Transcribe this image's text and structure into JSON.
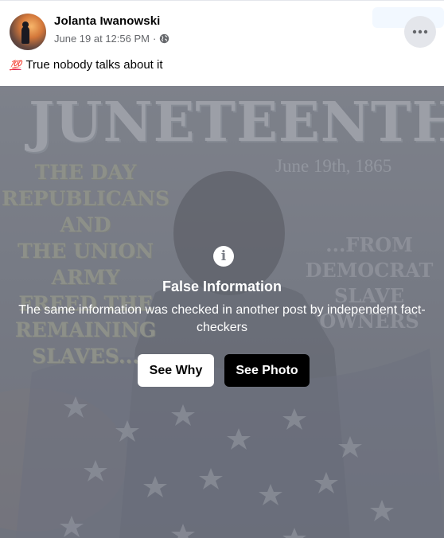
{
  "post": {
    "author": "Jolanta Iwanowski",
    "timestamp": "June 19 at 12:56 PM",
    "separator": "·",
    "audience_icon": "globe-icon",
    "more_icon": "more-horizontal-icon",
    "caption_emoji": "💯",
    "caption_text": "True nobody talks about it"
  },
  "image_background": {
    "title": "JUNETEENTH",
    "date": "June 19th, 1865",
    "left_text": [
      "THE DAY",
      "REPUBLICANS",
      "AND",
      "THE UNION",
      "ARMY",
      "FREED THE",
      "REMAINING",
      "SLAVES..."
    ],
    "right_text": [
      "...FROM",
      "DEMOCRAT",
      "SLAVE OWNERS"
    ]
  },
  "fact_check": {
    "icon": "info-icon",
    "title": "False Information",
    "description": "The same information was checked in another post by independent fact-checkers",
    "see_why_label": "See Why",
    "see_photo_label": "See Photo"
  },
  "colors": {
    "overlay": "#6e737e",
    "button_light": "#ffffff",
    "button_dark": "#000000",
    "secondary_text": "#65676b"
  }
}
